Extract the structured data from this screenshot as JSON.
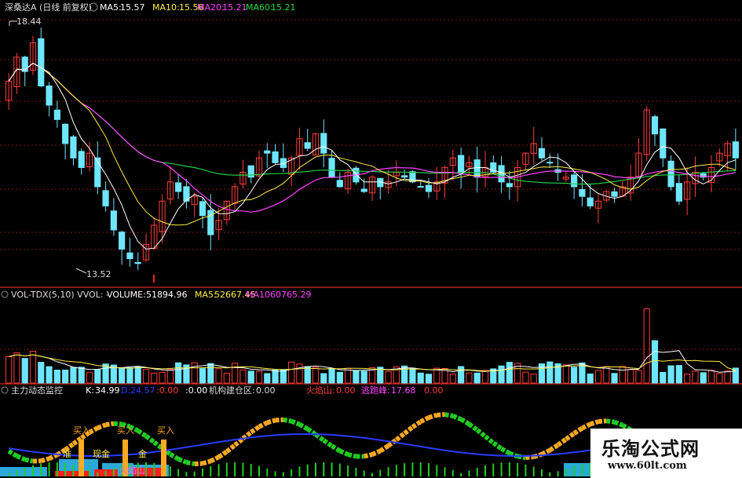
{
  "colors": {
    "bg": "#000000",
    "up": "#ff3c3c",
    "down": "#6fe6ff",
    "ma5": "#ffffff",
    "ma10": "#ffee44",
    "ma20": "#ff44ff",
    "ma60": "#22cc44",
    "grid": "#7a1a1a",
    "white": "#ffffff",
    "blue": "#2a3cff",
    "green": "#22cc22",
    "orange": "#ffaa22"
  },
  "price_panel": {
    "title": "深桑达A (日线 前复权)",
    "ma5_label": "MA5:",
    "ma5_value": "15.57",
    "ma10_label": "MA10:",
    "ma10_value": "15.56",
    "ma20_label": "MA20:",
    "ma20_value": "15.21",
    "ma60_label": "MA60:",
    "ma60_value": "15.21",
    "high_marker": "18.44",
    "low_marker": "13.52"
  },
  "volume_panel": {
    "indicator_label": "VOL-TDX(5,10) VVOL: -",
    "volume_label": "VOLUME:",
    "volume_value": "51894.96",
    "ma5_label": "MA5:",
    "ma5_value": "52667.45",
    "ma10_label": "MA10",
    "ma10_value": "60765.29"
  },
  "monitor_panel": {
    "title": "主力动态监控",
    "k_label": "K:",
    "k_value": "34.99",
    "d_label": "D:",
    "d_value": "24.57",
    "x_value": ":0.00",
    "y_value": ":0.00",
    "inst_label": "机构建仓区:",
    "inst_value": "0.00",
    "volcano_label": "火焰山:",
    "volcano_value": "0.00",
    "escape_label": "逃跑峰:",
    "escape_value": "17.68",
    "extra_value": "0.00",
    "buy_labels": [
      "买入",
      "买入",
      "买入"
    ],
    "zone_labels": [
      "准",
      "现金",
      "金",
      "火焰山"
    ]
  },
  "watermark": {
    "title": "乐淘公式网",
    "url": "www.60lt.com"
  },
  "chart_data": {
    "type": "candlestick",
    "panels": [
      "price",
      "volume",
      "indicator"
    ],
    "price": {
      "high": 18.44,
      "low": 13.52,
      "ma5": 15.57,
      "ma10": 15.56,
      "ma20": 15.21,
      "ma60": 15.21,
      "closes": [
        17.4,
        17.9,
        17.6,
        18.2,
        17.3,
        16.9,
        16.6,
        16.1,
        15.8,
        15.6,
        15.9,
        15.2,
        14.8,
        14.3,
        13.9,
        13.7,
        13.6,
        14.0,
        14.4,
        14.9,
        15.3,
        15.1,
        14.9,
        15.0,
        14.6,
        14.2,
        14.5,
        14.9,
        15.2,
        15.5,
        15.4,
        15.8,
        15.9,
        15.7,
        15.6,
        15.8,
        16.2,
        16.0,
        16.3,
        15.9,
        15.4,
        15.2,
        15.5,
        15.3,
        15.1,
        15.4,
        15.2,
        15.3,
        15.5,
        15.4,
        15.3,
        15.2,
        15.1,
        15.3,
        15.6,
        15.8,
        15.5,
        15.7,
        15.4,
        15.6,
        15.5,
        15.3,
        15.2,
        15.6,
        15.9,
        16.1,
        15.8,
        15.7,
        15.5,
        15.4,
        15.2,
        15.0,
        14.8,
        14.9,
        15.1,
        15.0,
        15.2,
        15.4,
        15.9,
        16.8,
        16.3,
        15.8,
        15.2,
        14.9,
        15.3,
        15.5,
        15.4,
        15.6,
        15.9,
        16.1,
        15.8
      ]
    },
    "volume": {
      "last": 51894.96,
      "ma5": 52667.45,
      "ma10": 60765.29
    },
    "indicator": {
      "K": 34.99,
      "D": 24.57,
      "escape_peak": 17.68
    }
  }
}
